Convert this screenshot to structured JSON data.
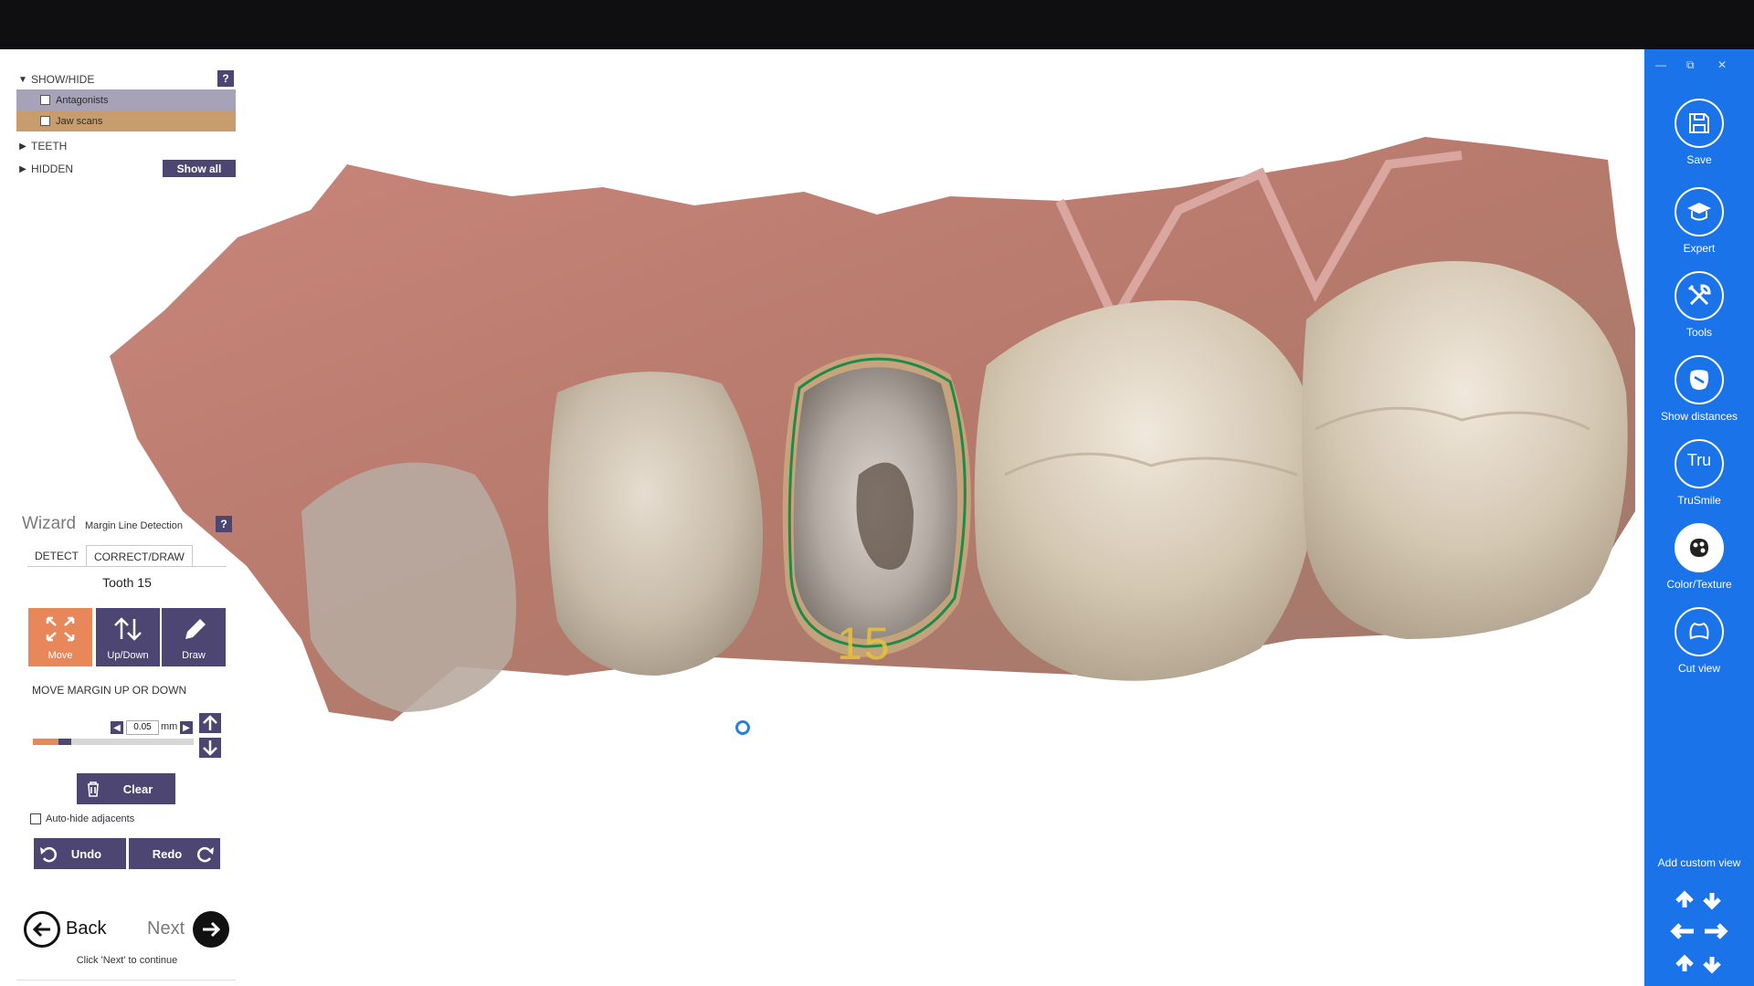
{
  "left_panel": {
    "show_hide": {
      "title": "SHOW/HIDE",
      "help": "?",
      "items": [
        {
          "label": "Antagonists",
          "checked": false,
          "bg": "#a6a2b8"
        },
        {
          "label": "Jaw scans",
          "checked": false,
          "bg": "#c89d6e"
        }
      ]
    },
    "teeth": {
      "title": "TEETH"
    },
    "hidden": {
      "title": "HIDDEN",
      "show_all": "Show all"
    }
  },
  "wizard": {
    "title": "Wizard",
    "subtitle": "Margin Line Detection",
    "help": "?",
    "tabs": [
      {
        "label": "DETECT",
        "active": false
      },
      {
        "label": "CORRECT/DRAW",
        "active": true
      }
    ],
    "tooth": "Tooth 15",
    "tools": [
      {
        "label": "Move",
        "icon": "move-icon",
        "active": true,
        "color": "#e8875a"
      },
      {
        "label": "Up/Down",
        "icon": "up-down-icon",
        "active": false,
        "color": "#4d4572"
      },
      {
        "label": "Draw",
        "icon": "pencil-icon",
        "active": false,
        "color": "#4d4572"
      }
    ],
    "move_label": "MOVE MARGIN UP OR DOWN",
    "step_value": "0.05",
    "step_unit": "mm",
    "slider_value_fraction": 0.2,
    "clear": "Clear",
    "auto_hide": "Auto-hide adjacents",
    "auto_hide_checked": false,
    "undo": "Undo",
    "redo": "Redo"
  },
  "navigation": {
    "back": "Back",
    "next": "Next",
    "hint": "Click 'Next' to continue"
  },
  "scan": {
    "tooth_number_label": "15",
    "margin_line_color": "#1e8a4a",
    "label_color": "#e8c23a"
  },
  "sidebar": {
    "bg": "#1a73e8",
    "items": [
      {
        "label": "Save",
        "icon": "save-icon"
      },
      {
        "label": "Expert",
        "icon": "graduation-cap-icon"
      },
      {
        "label": "Tools",
        "icon": "tools-icon"
      },
      {
        "label": "Show distances",
        "icon": "show-distances-icon"
      },
      {
        "label": "TruSmile",
        "icon": "trusmile-icon",
        "glyph": "Tru"
      },
      {
        "label": "Color/Texture",
        "icon": "palette-icon"
      },
      {
        "label": "Cut view",
        "icon": "cut-view-icon"
      }
    ],
    "add_custom_view": "Add custom view"
  }
}
